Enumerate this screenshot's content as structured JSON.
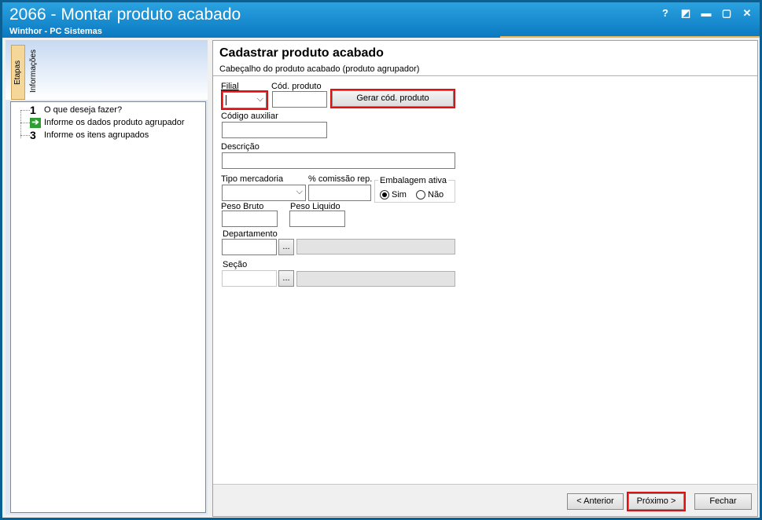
{
  "window": {
    "title": "2066 - Montar produto acabado",
    "subtitle": "Winthor - PC Sistemas",
    "controls": {
      "help": "?",
      "restore_glyph": "◩",
      "minimize": "▬",
      "maximize": "▢",
      "close": "✕"
    }
  },
  "sidebar": {
    "tabs": {
      "etapas": "Etapas",
      "informacoes": "Informações"
    },
    "steps": [
      {
        "number": "1",
        "label": "O que deseja fazer?"
      },
      {
        "number": "",
        "label": "Informe os dados produto agrupador",
        "icon": "arrow-right-icon"
      },
      {
        "number": "3",
        "label": "Informe os itens agrupados"
      }
    ]
  },
  "form": {
    "title": "Cadastrar produto acabado",
    "subtitle": "Cabeçalho do produto acabado (produto agrupador)",
    "filial_label": "Filial",
    "filial_value": "",
    "cod_produto_label": "Cód. produto",
    "cod_produto_value": "",
    "gerar_button": "Gerar cód. produto",
    "codigo_auxiliar_label": "Código auxiliar",
    "descricao_label": "Descrição",
    "tipo_mercadoria_label": "Tipo mercadoria",
    "comissao_label": "% comissão rep.",
    "embalagem_label": "Embalagem ativa",
    "embalagem_sim": "Sim",
    "embalagem_nao": "Não",
    "embalagem_selected": "Sim",
    "peso_bruto_label": "Peso Bruto",
    "peso_liquido_label": "Peso Liquido",
    "departamento_label": "Departamento",
    "secao_label": "Seção",
    "lookup_button": "..."
  },
  "footer": {
    "anterior": "< Anterior",
    "proximo": "Próximo >",
    "fechar": "Fechar"
  },
  "colors": {
    "titlebar": "#1a8fd3",
    "highlight": "#e01010",
    "step_tab": "#f6d79a"
  }
}
